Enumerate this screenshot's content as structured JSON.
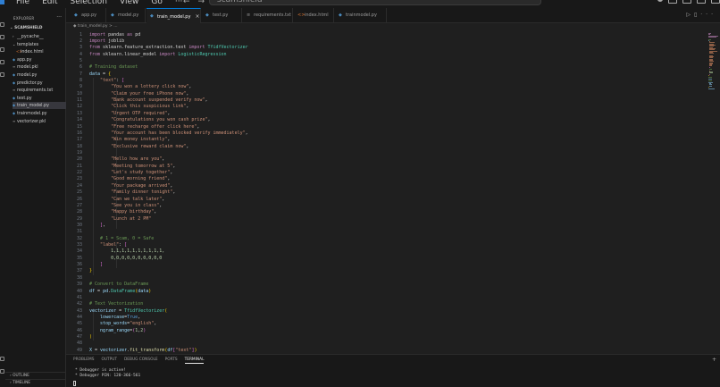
{
  "menu": [
    "File",
    "Edit",
    "Selection",
    "View",
    "Go",
    "···"
  ],
  "window": {
    "search_text": "scamshield"
  },
  "explorer": {
    "header": "EXPLORER",
    "folder": "SCAMSHIELD",
    "items": [
      {
        "label": "__pycache__",
        "icon": "›",
        "type": "folder",
        "depth": 1
      },
      {
        "label": "templates",
        "icon": "⌄",
        "type": "folder",
        "depth": 1
      },
      {
        "label": "index.html",
        "icon": "<>",
        "type": "html",
        "depth": 2
      },
      {
        "label": "app.py",
        "icon": "◆",
        "type": "python",
        "depth": 1
      },
      {
        "label": "model.pkl",
        "icon": "≡",
        "type": "file",
        "depth": 1
      },
      {
        "label": "model.py",
        "icon": "◆",
        "type": "python",
        "depth": 1
      },
      {
        "label": "predictor.py",
        "icon": "◆",
        "type": "python",
        "depth": 1
      },
      {
        "label": "requirements.txt",
        "icon": "≡",
        "type": "file",
        "depth": 1
      },
      {
        "label": "test.py",
        "icon": "◆",
        "type": "python",
        "depth": 1
      },
      {
        "label": "train_model.py",
        "icon": "◆",
        "type": "python",
        "depth": 1,
        "selected": true
      },
      {
        "label": "trainmodel.py",
        "icon": "◆",
        "type": "python",
        "depth": 1
      },
      {
        "label": "vectorizer.pkl",
        "icon": "≡",
        "type": "file",
        "depth": 1
      }
    ],
    "outline": "OUTLINE",
    "timeline": "TIMELINE"
  },
  "tabs": [
    {
      "label": "app.py",
      "icon": "◆",
      "active": false
    },
    {
      "label": "model.py",
      "icon": "◆",
      "active": false
    },
    {
      "label": "train_model.py",
      "icon": "◆",
      "active": true
    },
    {
      "label": "test.py",
      "icon": "◆",
      "active": false
    },
    {
      "label": "requirements.txt",
      "icon": "≡",
      "active": false
    },
    {
      "label": "index.html",
      "icon": "<>",
      "active": false
    },
    {
      "label": "trainmodel.py",
      "icon": "◆",
      "active": false
    }
  ],
  "breadcrumb": "◆ train_model.py > ...",
  "code": [
    [
      [
        "kw",
        "import"
      ],
      [
        "txt",
        " pandas "
      ],
      [
        "kw",
        "as"
      ],
      [
        "txt",
        " pd"
      ]
    ],
    [
      [
        "kw",
        "import"
      ],
      [
        "txt",
        " joblib"
      ]
    ],
    [
      [
        "kw",
        "from"
      ],
      [
        "txt",
        " sklearn.feature_extraction.text "
      ],
      [
        "kw",
        "import"
      ],
      [
        "txt",
        " "
      ],
      [
        "cls",
        "TfidfVectorizer"
      ]
    ],
    [
      [
        "kw",
        "from"
      ],
      [
        "txt",
        " sklearn.linear_model "
      ],
      [
        "kw",
        "import"
      ],
      [
        "txt",
        " "
      ],
      [
        "cls",
        "LogisticRegression"
      ]
    ],
    [],
    [
      [
        "com",
        "# Training dataset"
      ]
    ],
    [
      [
        "var",
        "data"
      ],
      [
        "txt",
        " = "
      ],
      [
        "br1",
        "{"
      ]
    ],
    [
      [
        "txt",
        "    "
      ],
      [
        "str",
        "\"text\""
      ],
      [
        "txt",
        ": "
      ],
      [
        "br2",
        "["
      ]
    ],
    [
      [
        "txt",
        "        "
      ],
      [
        "str",
        "\"You won a lottery click now\""
      ],
      [
        "txt",
        ","
      ]
    ],
    [
      [
        "txt",
        "        "
      ],
      [
        "str",
        "\"Claim your free iPhone now\""
      ],
      [
        "txt",
        ","
      ]
    ],
    [
      [
        "txt",
        "        "
      ],
      [
        "str",
        "\"Bank account suspended verify now\""
      ],
      [
        "txt",
        ","
      ]
    ],
    [
      [
        "txt",
        "        "
      ],
      [
        "str",
        "\"Click this suspicious link\""
      ],
      [
        "txt",
        ","
      ]
    ],
    [
      [
        "txt",
        "        "
      ],
      [
        "str",
        "\"Urgent OTP required\""
      ],
      [
        "txt",
        ","
      ]
    ],
    [
      [
        "txt",
        "        "
      ],
      [
        "str",
        "\"Congratulations you won cash prize\""
      ],
      [
        "txt",
        ","
      ]
    ],
    [
      [
        "txt",
        "        "
      ],
      [
        "str",
        "\"Free recharge offer click here\""
      ],
      [
        "txt",
        ","
      ]
    ],
    [
      [
        "txt",
        "        "
      ],
      [
        "str",
        "\"Your account has been blocked verify immediately\""
      ],
      [
        "txt",
        ","
      ]
    ],
    [
      [
        "txt",
        "        "
      ],
      [
        "str",
        "\"Win money instantly\""
      ],
      [
        "txt",
        ","
      ]
    ],
    [
      [
        "txt",
        "        "
      ],
      [
        "str",
        "\"Exclusive reward claim now\""
      ],
      [
        "txt",
        ","
      ]
    ],
    [],
    [
      [
        "txt",
        "        "
      ],
      [
        "str",
        "\"Hello how are you\""
      ],
      [
        "txt",
        ","
      ]
    ],
    [
      [
        "txt",
        "        "
      ],
      [
        "str",
        "\"Meeting tomorrow at 5\""
      ],
      [
        "txt",
        ","
      ]
    ],
    [
      [
        "txt",
        "        "
      ],
      [
        "str",
        "\"Let's study together\""
      ],
      [
        "txt",
        ","
      ]
    ],
    [
      [
        "txt",
        "        "
      ],
      [
        "str",
        "\"Good morning friend\""
      ],
      [
        "txt",
        ","
      ]
    ],
    [
      [
        "txt",
        "        "
      ],
      [
        "str",
        "\"Your package arrived\""
      ],
      [
        "txt",
        ","
      ]
    ],
    [
      [
        "txt",
        "        "
      ],
      [
        "str",
        "\"Family dinner tonight\""
      ],
      [
        "txt",
        ","
      ]
    ],
    [
      [
        "txt",
        "        "
      ],
      [
        "str",
        "\"Can we talk later\""
      ],
      [
        "txt",
        ","
      ]
    ],
    [
      [
        "txt",
        "        "
      ],
      [
        "str",
        "\"See you in class\""
      ],
      [
        "txt",
        ","
      ]
    ],
    [
      [
        "txt",
        "        "
      ],
      [
        "str",
        "\"Happy birthday\""
      ],
      [
        "txt",
        ","
      ]
    ],
    [
      [
        "txt",
        "        "
      ],
      [
        "str",
        "\"Lunch at 2 PM\""
      ]
    ],
    [
      [
        "txt",
        "    "
      ],
      [
        "br2",
        "]"
      ],
      [
        "txt",
        ","
      ]
    ],
    [],
    [
      [
        "txt",
        "    "
      ],
      [
        "com",
        "# 1 = Scam, 0 = Safe"
      ]
    ],
    [
      [
        "txt",
        "    "
      ],
      [
        "str",
        "\"label\""
      ],
      [
        "txt",
        ": "
      ],
      [
        "br2",
        "["
      ]
    ],
    [
      [
        "txt",
        "        "
      ],
      [
        "num",
        "1,1,1,1,1,1,1,1,1,1,"
      ]
    ],
    [
      [
        "txt",
        "        "
      ],
      [
        "num",
        "0,0,0,0,0,0,0,0,0,0"
      ]
    ],
    [
      [
        "txt",
        "    "
      ],
      [
        "br2",
        "]"
      ]
    ],
    [
      [
        "br1",
        "}"
      ]
    ],
    [],
    [
      [
        "com",
        "# Convert to DataFrame"
      ]
    ],
    [
      [
        "var",
        "df"
      ],
      [
        "txt",
        " = "
      ],
      [
        "var",
        "pd"
      ],
      [
        "txt",
        "."
      ],
      [
        "cls",
        "DataFrame"
      ],
      [
        "br1",
        "("
      ],
      [
        "var",
        "data"
      ],
      [
        "br1",
        ")"
      ]
    ],
    [],
    [
      [
        "com",
        "# Text Vectorization"
      ]
    ],
    [
      [
        "var",
        "vectorizer"
      ],
      [
        "txt",
        " = "
      ],
      [
        "cls",
        "TfidfVectorizer"
      ],
      [
        "br1",
        "("
      ]
    ],
    [
      [
        "txt",
        "    "
      ],
      [
        "var",
        "lowercase"
      ],
      [
        "txt",
        "="
      ],
      [
        "kw2",
        "True"
      ],
      [
        "txt",
        ","
      ]
    ],
    [
      [
        "txt",
        "    "
      ],
      [
        "var",
        "stop_words"
      ],
      [
        "txt",
        "="
      ],
      [
        "str",
        "\"english\""
      ],
      [
        "txt",
        ","
      ]
    ],
    [
      [
        "txt",
        "    "
      ],
      [
        "var",
        "ngram_range"
      ],
      [
        "txt",
        "="
      ],
      [
        "br2",
        "("
      ],
      [
        "num",
        "1"
      ],
      [
        "txt",
        ","
      ],
      [
        "num",
        "2"
      ],
      [
        "br2",
        ")"
      ]
    ],
    [
      [
        "br1",
        ")"
      ]
    ],
    [],
    [
      [
        "var",
        "X"
      ],
      [
        "txt",
        " = "
      ],
      [
        "var",
        "vectorizer"
      ],
      [
        "txt",
        "."
      ],
      [
        "fn",
        "fit_transform"
      ],
      [
        "br1",
        "("
      ],
      [
        "var",
        "df"
      ],
      [
        "br2",
        "["
      ],
      [
        "str",
        "\"text\""
      ],
      [
        "br2",
        "]"
      ],
      [
        "br1",
        ")"
      ]
    ]
  ],
  "panel": {
    "tabs": [
      "PROBLEMS",
      "OUTPUT",
      "DEBUG CONSOLE",
      "PORTS",
      "TERMINAL"
    ],
    "active_tab": "TERMINAL",
    "lines": [
      " * Debugger is active!",
      " * Debugger PIN: 120-366-561"
    ]
  }
}
